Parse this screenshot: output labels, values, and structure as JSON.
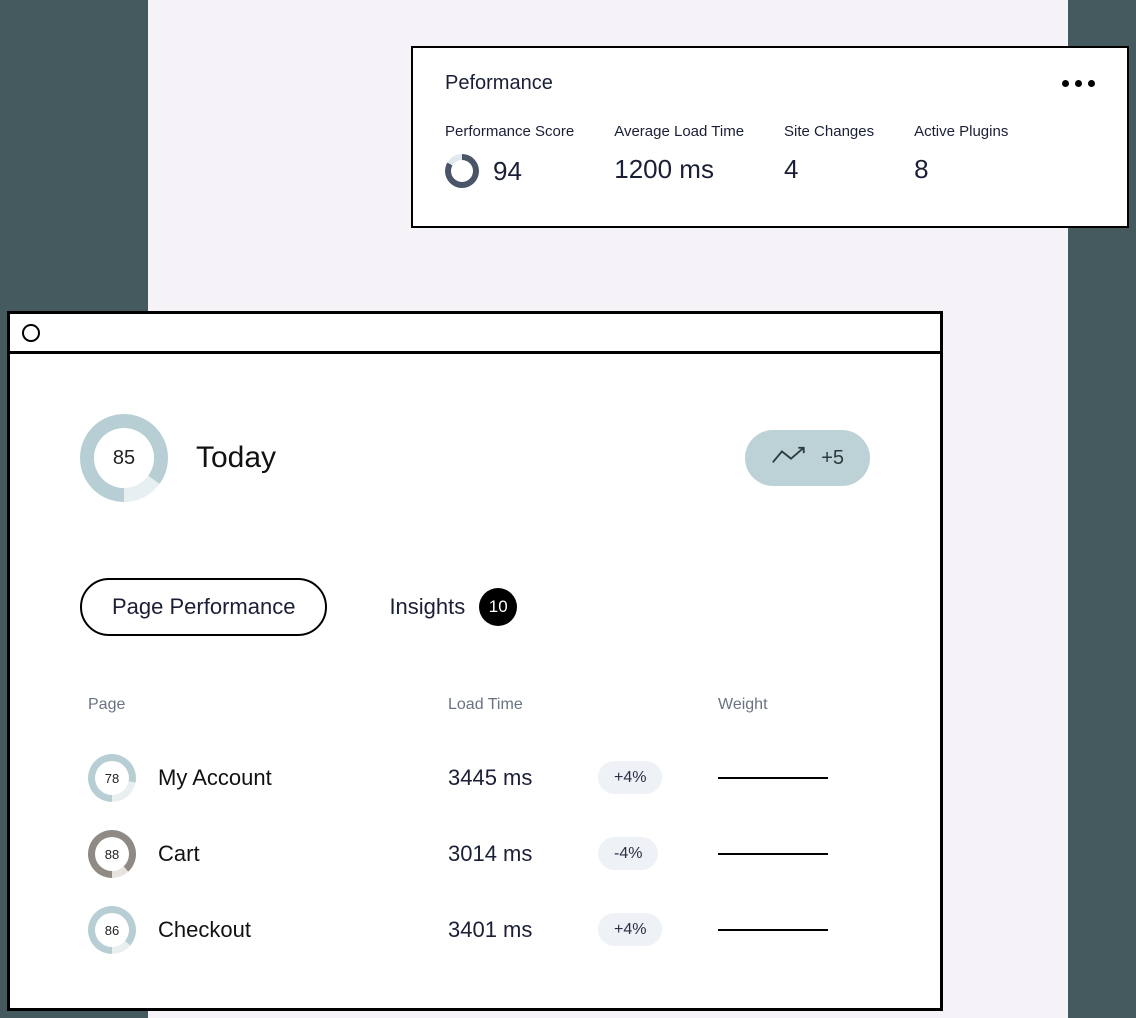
{
  "perf_card": {
    "title": "Peformance",
    "metrics": {
      "score": {
        "label": "Performance Score",
        "value": "94"
      },
      "load": {
        "label": "Average Load Time",
        "value": "1200 ms"
      },
      "changes": {
        "label": "Site Changes",
        "value": "4"
      },
      "plugins": {
        "label": "Active Plugins",
        "value": "8"
      }
    }
  },
  "dashboard": {
    "today": {
      "score": "85",
      "label": "Today"
    },
    "trend": "+5",
    "tabs": {
      "page_perf": "Page Performance",
      "insights": "Insights",
      "insights_count": "10"
    },
    "columns": {
      "page": "Page",
      "load": "Load Time",
      "weight": "Weight"
    },
    "rows": [
      {
        "score": "78",
        "name": "My Account",
        "load": "3445 ms",
        "delta": "+4%"
      },
      {
        "score": "88",
        "name": "Cart",
        "load": "3014 ms",
        "delta": "-4%"
      },
      {
        "score": "86",
        "name": "Checkout",
        "load": "3401 ms",
        "delta": "+4%"
      }
    ]
  }
}
